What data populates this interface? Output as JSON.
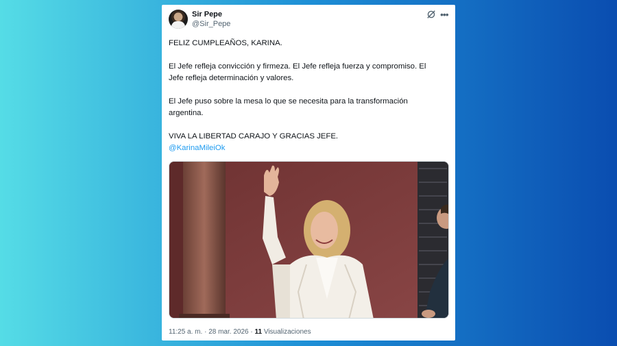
{
  "author": {
    "name": "Sir Pepe",
    "handle": "@Sir_Pepe"
  },
  "icons": {
    "grok": "grok-icon",
    "more": "more-options-icon"
  },
  "tweet": {
    "line1": "FELIZ CUMPLEAÑOS, KARINA.",
    "line2": "El Jefe refleja convicción y firmeza. El Jefe refleja fuerza y compromiso. El Jefe refleja determinación y valores.",
    "line3": "El Jefe puso sobre la mesa lo que se necesita para la transformación argentina.",
    "line4": "VIVA LA LIBERTAD CARAJO Y GRACIAS JEFE.",
    "mention": "@KarinaMileiOk"
  },
  "footer": {
    "time": "11:25 a. m.",
    "sep1": "·",
    "date": "28 mar. 2026",
    "sep2": "·",
    "views_count": "11",
    "views_label": "Visualizaciones"
  },
  "colors": {
    "link": "#1d9bf0",
    "text": "#0f1419",
    "muted": "#536471"
  }
}
